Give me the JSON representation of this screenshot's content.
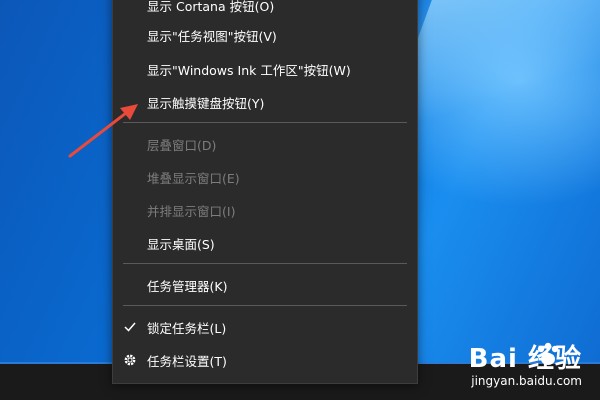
{
  "context_menu": {
    "items": [
      {
        "label": "显示 Cortana 按钮(O)",
        "disabled": false
      },
      {
        "label": "显示\"任务视图\"按钮(V)",
        "disabled": false
      },
      {
        "label": "显示\"Windows Ink 工作区\"按钮(W)",
        "disabled": false
      },
      {
        "label": "显示触摸键盘按钮(Y)",
        "disabled": false
      },
      {
        "label": "层叠窗口(D)",
        "disabled": true
      },
      {
        "label": "堆叠显示窗口(E)",
        "disabled": true
      },
      {
        "label": "并排显示窗口(I)",
        "disabled": true
      },
      {
        "label": "显示桌面(S)",
        "disabled": false
      },
      {
        "label": "任务管理器(K)",
        "disabled": false
      },
      {
        "label": "锁定任务栏(L)",
        "disabled": false,
        "checked": true
      },
      {
        "label": "任务栏设置(T)",
        "disabled": false,
        "icon": "gear-icon"
      }
    ]
  },
  "watermark": {
    "brand": "Bai  经验",
    "url": "jingyan.baidu.com"
  },
  "colors": {
    "menu_bg": "#2b2b2b",
    "arrow": "#e84a3c",
    "disabled_text": "#7d7d7d"
  }
}
